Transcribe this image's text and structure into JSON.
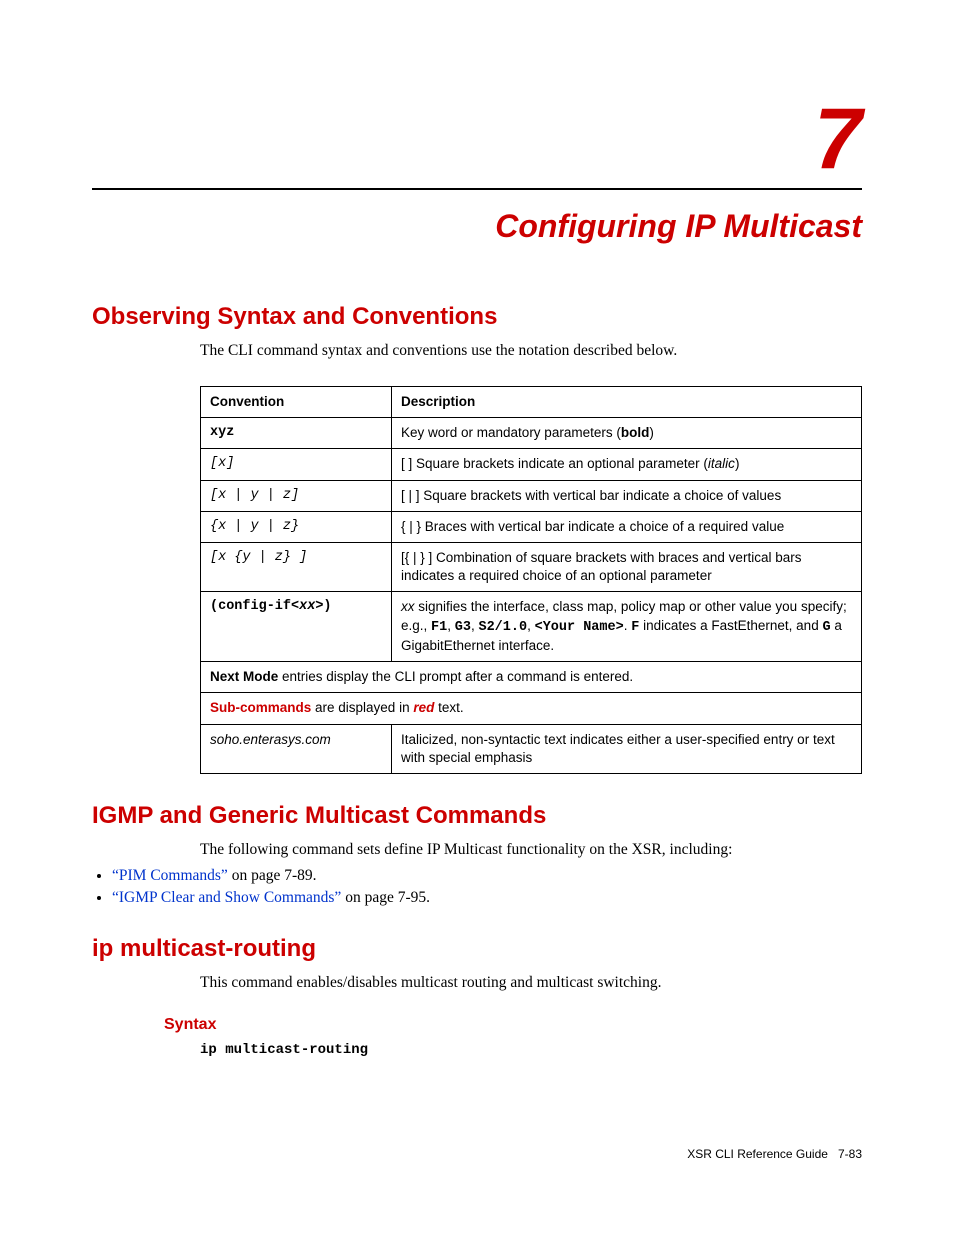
{
  "chapter_number": "7",
  "chapter_title": "Configuring IP Multicast",
  "section1": {
    "heading": "Observing Syntax and Conventions",
    "intro": "The CLI command syntax and conventions use the notation described below."
  },
  "table": {
    "heads": {
      "c1": "Convention",
      "c2": "Description"
    },
    "rows": {
      "r1": {
        "conv": "xyz",
        "desc_pre": "Key word or mandatory parameters (",
        "desc_bold": "bold",
        "desc_post": ")"
      },
      "r2": {
        "conv": "[x]",
        "desc_pre": "[ ] Square brackets indicate an optional parameter (",
        "desc_italic": "italic",
        "desc_post": ")"
      },
      "r3": {
        "conv": "[x | y | z]",
        "desc": "[ | ] Square brackets with vertical bar indicate a choice of values"
      },
      "r4": {
        "conv": "{x | y | z}",
        "desc": "{ | } Braces with vertical bar indicate a choice of a required value"
      },
      "r5": {
        "conv": "[x {y | z} ]",
        "desc": "[{ | } ] Combination of square brackets with braces and vertical bars indicates a required choice of an optional parameter"
      },
      "r6": {
        "conv_pre": "(config-if<",
        "conv_xx": "xx",
        "conv_post": ">)",
        "d_xx": "xx",
        "d_t1": " signifies the interface, class map, policy map or other value you specify; e.g., ",
        "d_f1": "F1",
        "d_c1": ", ",
        "d_g3": "G3",
        "d_c2": ", ",
        "d_s2": "S2/1.0",
        "d_c3": ", ",
        "d_yn": "<Your Name>",
        "d_t2": ". ",
        "d_f": "F",
        "d_t3": " indicates a FastEthernet, and ",
        "d_g": "G",
        "d_t4": " a GigabitEthernet interface."
      },
      "r7": {
        "bold": "Next Mode",
        "rest": " entries display the CLI prompt after a command is entered."
      },
      "r8": {
        "bold1": "Sub-commands",
        "mid": " are displayed in ",
        "bold2": "red",
        "end": " text."
      },
      "r9": {
        "conv": "soho.enterasys.com",
        "desc": "Italicized, non-syntactic text indicates either a user-specified entry or text with special emphasis"
      }
    }
  },
  "section2": {
    "heading": "IGMP and Generic Multicast Commands",
    "intro": "The following command sets define IP Multicast functionality on the XSR, including:",
    "b1": {
      "link": "“PIM Commands”",
      "tail": " on page 7-89."
    },
    "b2": {
      "link": "“IGMP Clear and Show Commands”",
      "tail": " on page 7-95."
    }
  },
  "section3": {
    "heading": "ip multicast-routing",
    "intro": "This command enables/disables multicast routing and multicast switching.",
    "syntax_heading": "Syntax",
    "syntax_code": "ip multicast-routing"
  },
  "footer": {
    "guide": "XSR CLI Reference Guide",
    "page": "7-83"
  }
}
